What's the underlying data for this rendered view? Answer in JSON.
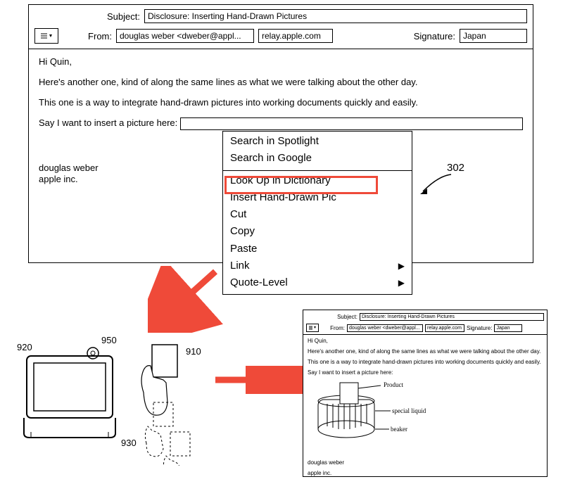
{
  "top_window": {
    "subject_label": "Subject:",
    "subject_value": "Disclosure: Inserting Hand-Drawn Pictures",
    "from_label": "From:",
    "from_value": "douglas weber <dweber@appl...",
    "relay": "relay.apple.com",
    "signature_label": "Signature:",
    "signature_value": "Japan",
    "body": {
      "greeting": "Hi Quin,",
      "line1": "Here's another one, kind of along the same lines as what we were talking about the other day.",
      "line2": "This one is a way to integrate hand-drawn pictures into working documents quickly and easily.",
      "insert_prefix": "Say I want to insert a picture here:"
    },
    "signature_block": {
      "name": "douglas weber",
      "company": "apple inc."
    }
  },
  "context_menu": {
    "spotlight": "Search in Spotlight",
    "google": "Search in Google",
    "lookup": "Look Up in Dictionary",
    "insert_pic": "Insert Hand-Drawn Pic",
    "cut": "Cut",
    "copy": "Copy",
    "paste": "Paste",
    "link": "Link",
    "quote": "Quote-Level"
  },
  "callouts": {
    "ref_302": "302",
    "ref_920": "920",
    "ref_950": "950",
    "ref_910": "910",
    "ref_930": "930"
  },
  "small_window": {
    "subject_label": "Subject:",
    "subject_value": "Disclosure: Inserting Hand-Drawn Pictures",
    "from_label": "From:",
    "from_value": "douglas weber <dweber@appl...",
    "relay": "relay.apple.com",
    "signature_label": "Signature:",
    "signature_value": "Japan",
    "body": {
      "greeting": "Hi Quin,",
      "line1": "Here's another one, kind of along the same lines as what we were talking about the other day.",
      "line2": "This one is a way to integrate hand-drawn pictures into working documents quickly and easily.",
      "insert_prefix": "Say I want to insert a picture here:"
    },
    "sketch_labels": {
      "product": "Product",
      "liquid": "special liquid",
      "beaker": "beaker"
    },
    "signature_block": {
      "name": "douglas weber",
      "company": "apple inc."
    }
  }
}
